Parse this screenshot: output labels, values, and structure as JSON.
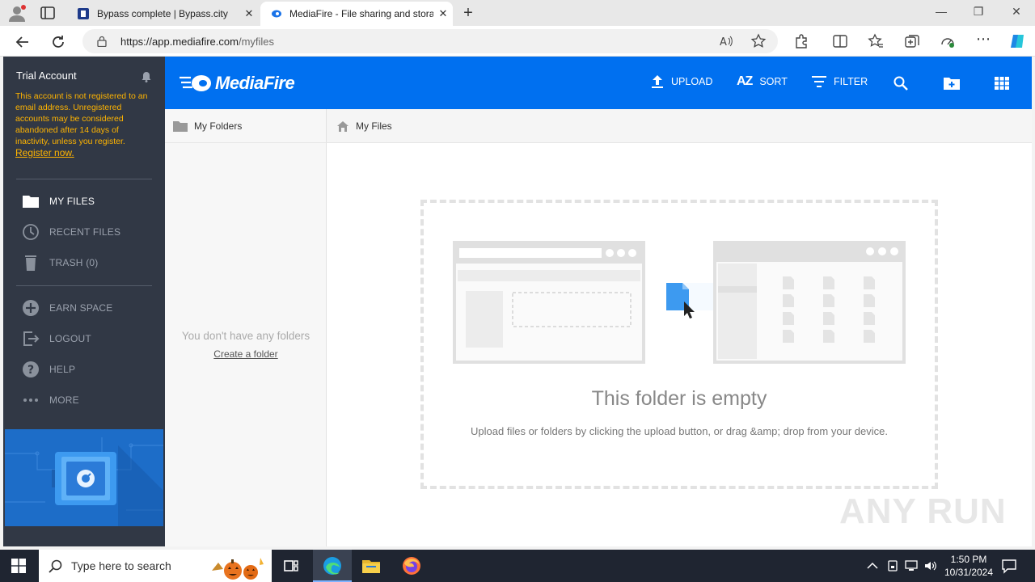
{
  "browser": {
    "tabs": [
      {
        "title": "Bypass complete | Bypass.city"
      },
      {
        "title": "MediaFire - File sharing and stora"
      }
    ],
    "url_host": "https://app.mediafire.com",
    "url_path": "/myfiles"
  },
  "sidebar": {
    "account_title": "Trial Account",
    "account_message": "This account is not registered to an email address. Unregistered accounts may be considered abandoned after 14 days of inactivity, unless you register.",
    "register_link": "Register now.",
    "items": [
      {
        "label": "MY FILES",
        "icon": "folder-icon"
      },
      {
        "label": "RECENT FILES",
        "icon": "clock-icon"
      },
      {
        "label": "TRASH (0)",
        "icon": "trash-icon"
      },
      {
        "label": "EARN SPACE",
        "icon": "plus-circle-icon"
      },
      {
        "label": "LOGOUT",
        "icon": "logout-icon"
      },
      {
        "label": "HELP",
        "icon": "help-icon"
      },
      {
        "label": "MORE",
        "icon": "more-icon"
      }
    ]
  },
  "header": {
    "logo": "MediaFire",
    "upload_label": "UPLOAD",
    "sort_label": "SORT",
    "sort_icon_text": "AZ",
    "filter_label": "FILTER"
  },
  "folders": {
    "title": "My Folders",
    "empty_text": "You don't have any folders",
    "create_link": "Create a folder"
  },
  "main": {
    "breadcrumb": "My Files",
    "empty_title": "This folder is empty",
    "empty_message": "Upload files or folders by clicking the upload button, or drag &amp; drop from your device."
  },
  "taskbar": {
    "search_placeholder": "Type here to search",
    "time": "1:50 PM",
    "date": "10/31/2024"
  },
  "watermark": "ANY RUN",
  "colors": {
    "brand_blue": "#0070f0",
    "sidebar_bg": "#313845",
    "warning": "#ffb400"
  }
}
